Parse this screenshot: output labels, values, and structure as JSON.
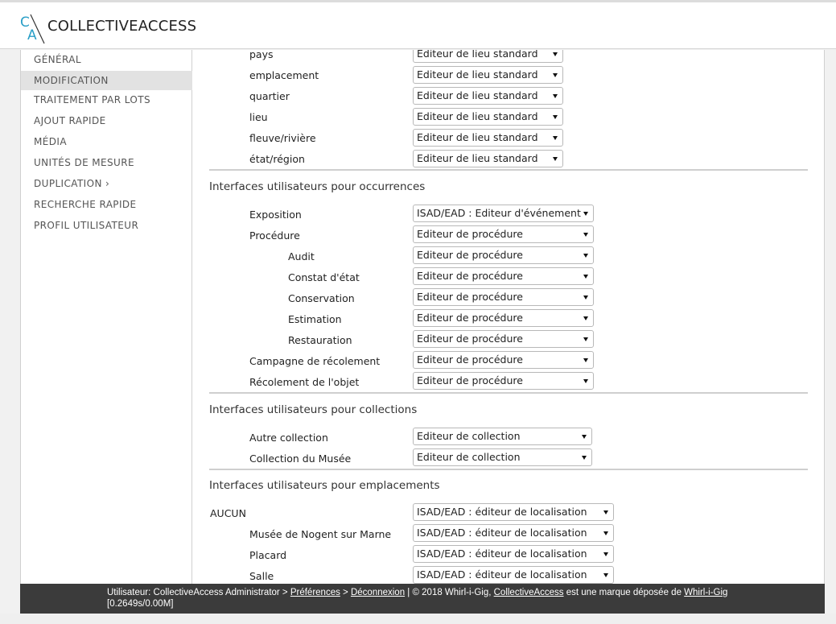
{
  "header": {
    "logo_text": "COLLECTIVEACCESS",
    "logo_mark_letters": "CA"
  },
  "sidebar": {
    "items": [
      {
        "label": "GÉNÉRAL"
      },
      {
        "label": "MODIFICATION",
        "active": true
      },
      {
        "label": "TRAITEMENT PAR LOTS"
      },
      {
        "label": "AJOUT RAPIDE"
      },
      {
        "label": "MÉDIA"
      },
      {
        "label": "UNITÉS DE MESURE"
      },
      {
        "label": "DUPLICATION ›"
      },
      {
        "label": "RECHERCHE RAPIDE"
      },
      {
        "label": "PROFIL UTILISATEUR"
      }
    ]
  },
  "places": {
    "rows": [
      {
        "label": "pays",
        "value": "Editeur de lieu standard"
      },
      {
        "label": "emplacement",
        "value": "Editeur de lieu standard"
      },
      {
        "label": "quartier",
        "value": "Editeur de lieu standard"
      },
      {
        "label": "lieu",
        "value": "Editeur de lieu standard"
      },
      {
        "label": "fleuve/rivière",
        "value": "Editeur de lieu standard"
      },
      {
        "label": "état/région",
        "value": "Editeur de lieu standard"
      }
    ]
  },
  "occurrences": {
    "title": "Interfaces utilisateurs pour occurrences",
    "rows": [
      {
        "label": "Exposition",
        "value": "ISAD/EAD : Editeur d'événement"
      },
      {
        "label": "Procédure",
        "value": "Editeur de procédure"
      },
      {
        "label": "Audit",
        "value": "Editeur de procédure"
      },
      {
        "label": "Constat d'état",
        "value": "Editeur de procédure"
      },
      {
        "label": "Conservation",
        "value": "Editeur de procédure"
      },
      {
        "label": "Estimation",
        "value": "Editeur de procédure"
      },
      {
        "label": "Restauration",
        "value": "Editeur de procédure"
      },
      {
        "label": "Campagne de récolement",
        "value": "Editeur de procédure"
      },
      {
        "label": "Récolement de l'objet",
        "value": "Editeur de procédure"
      }
    ]
  },
  "collections": {
    "title": "Interfaces utilisateurs pour collections",
    "rows": [
      {
        "label": "Autre collection",
        "value": "Editeur de collection"
      },
      {
        "label": "Collection du Musée",
        "value": "Editeur de collection"
      }
    ]
  },
  "locations": {
    "title": "Interfaces utilisateurs pour emplacements",
    "rows": [
      {
        "label": "AUCUN",
        "value": "ISAD/EAD : éditeur de localisation"
      },
      {
        "label": "Musée de Nogent sur Marne",
        "value": "ISAD/EAD : éditeur de localisation"
      },
      {
        "label": "Placard",
        "value": "ISAD/EAD : éditeur de localisation"
      },
      {
        "label": "Salle",
        "value": "ISAD/EAD : éditeur de localisation"
      }
    ]
  },
  "footer": {
    "user_prefix": "Utilisateur: CollectiveAccess Administrator > ",
    "preferences": "Préférences",
    "sep1": " > ",
    "logout": "Déconnexion",
    "sep2": "  |  © 2018 Whirl-i-Gig, ",
    "ca_link": "CollectiveAccess",
    "trademark": " est une marque déposée de ",
    "wig_link": "Whirl-i-Gig",
    "stats": "[0.2649s/0.00M]"
  }
}
